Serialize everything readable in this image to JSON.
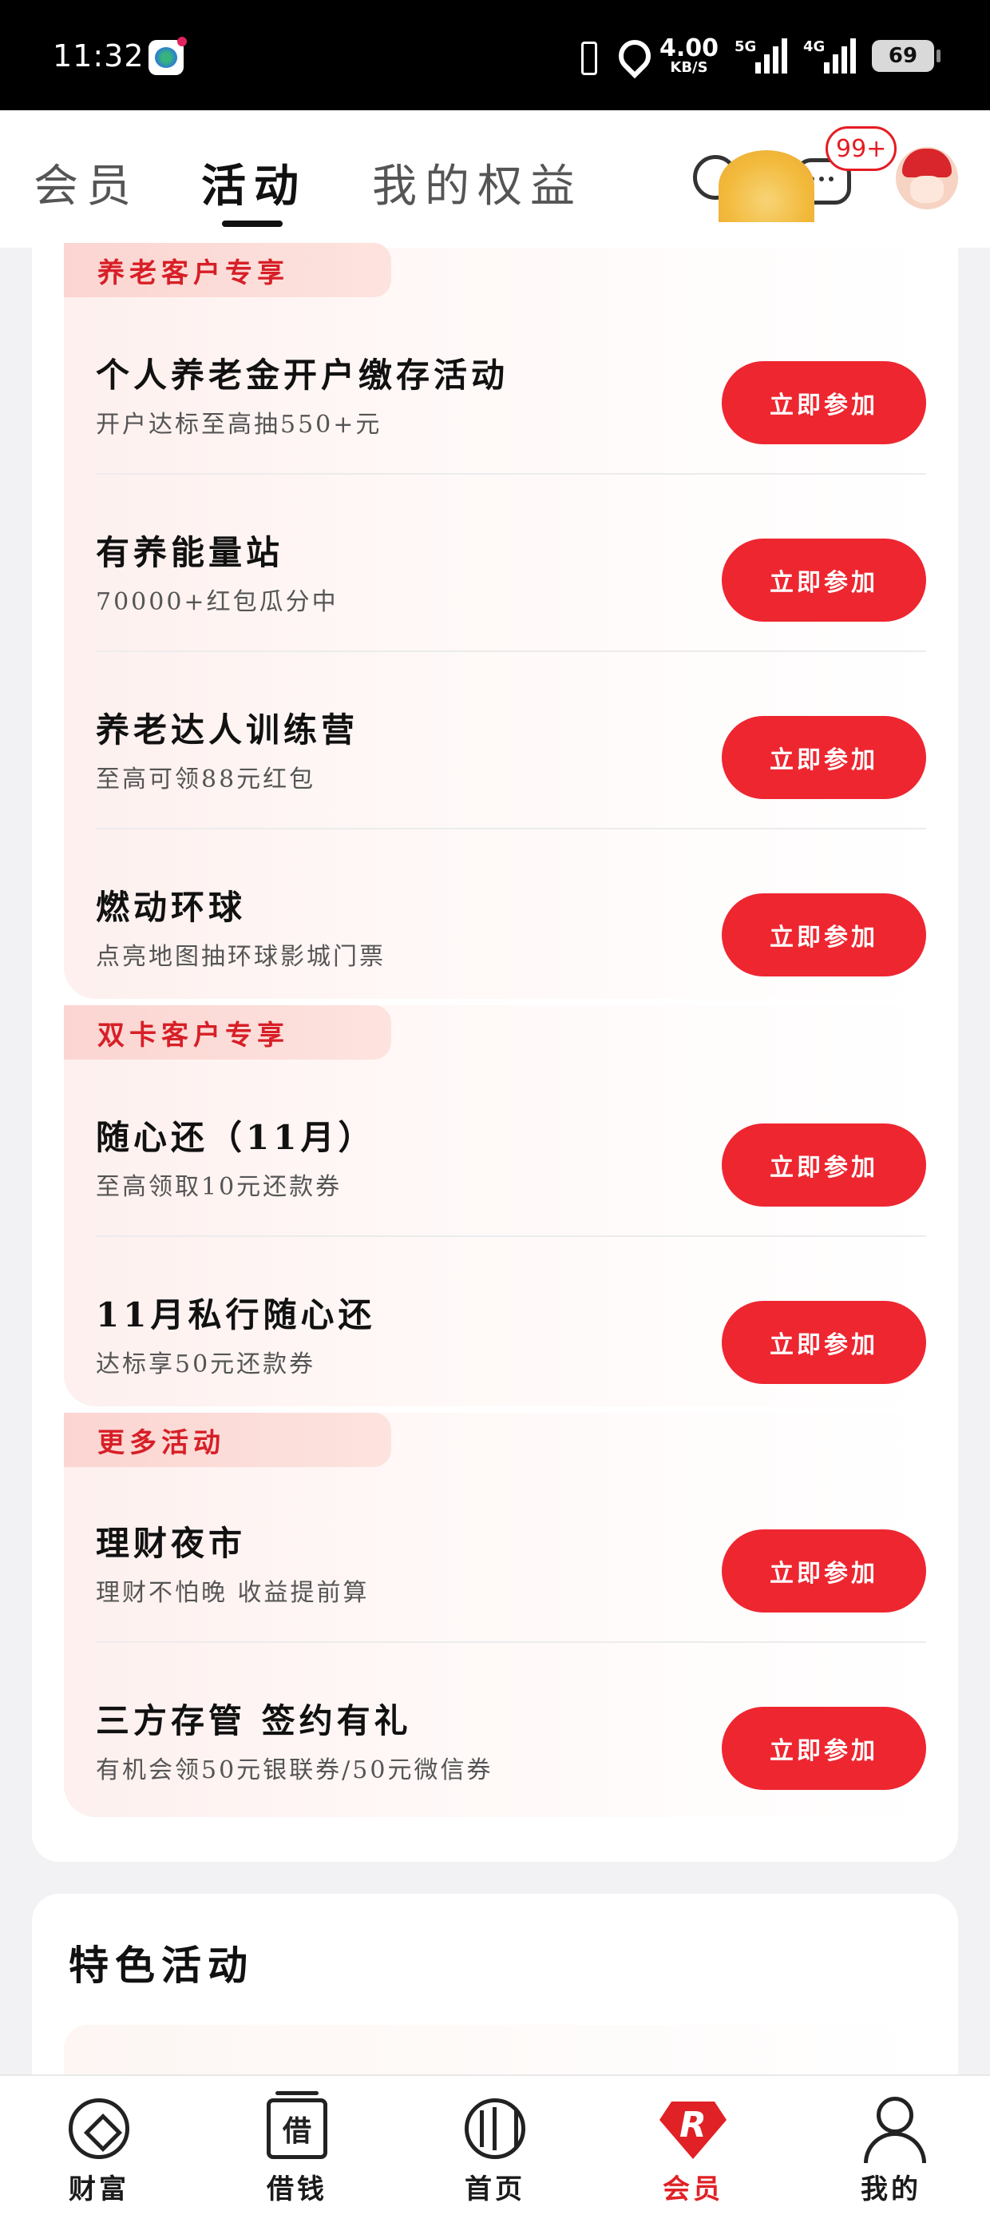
{
  "status_bar": {
    "time": "11:32",
    "net_speed_value": "4.00",
    "net_speed_unit": "KB/S",
    "sig1_label": "5G",
    "sig2_label": "4G",
    "battery": "69"
  },
  "top_nav": {
    "tabs": [
      {
        "label": "会员"
      },
      {
        "label": "活动"
      },
      {
        "label": "我的权益"
      }
    ],
    "active_tab": "活动",
    "message_badge": "99+"
  },
  "sections": [
    {
      "tag": "养老客户专享",
      "activities": [
        {
          "title": "个人养老金开户缴存活动",
          "subtitle": "开户达标至高抽550+元",
          "button": "立即参加"
        },
        {
          "title": "有养能量站",
          "subtitle": "70000+红包瓜分中",
          "button": "立即参加"
        },
        {
          "title": "养老达人训练营",
          "subtitle": "至高可领88元红包",
          "button": "立即参加"
        },
        {
          "title": "燃动环球",
          "subtitle": "点亮地图抽环球影城门票",
          "button": "立即参加"
        }
      ]
    },
    {
      "tag": "双卡客户专享",
      "activities": [
        {
          "title": "随心还（11月）",
          "subtitle": "至高领取10元还款券",
          "button": "立即参加"
        },
        {
          "title": "11月私行随心还",
          "subtitle": "达标享50元还款券",
          "button": "立即参加"
        }
      ]
    },
    {
      "tag": "更多活动",
      "activities": [
        {
          "title": "理财夜市",
          "subtitle": "理财不怕晚 收益提前算",
          "button": "立即参加"
        },
        {
          "title": "三方存管 签约有礼",
          "subtitle": "有机会领50元银联券/50元微信券",
          "button": "立即参加"
        }
      ]
    }
  ],
  "featured": {
    "title": "特色活动"
  },
  "bottom_nav": {
    "items": [
      {
        "label": "财富",
        "icon": "wealth-icon"
      },
      {
        "label": "借钱",
        "icon": "borrow-icon",
        "glyph": "借"
      },
      {
        "label": "首页",
        "icon": "home-icon"
      },
      {
        "label": "会员",
        "icon": "member-icon",
        "glyph": "R"
      },
      {
        "label": "我的",
        "icon": "profile-icon"
      }
    ],
    "active": "会员",
    "active_color": "#e02126"
  },
  "colors": {
    "accent": "#ee2630",
    "tag_text": "#d71f27"
  }
}
